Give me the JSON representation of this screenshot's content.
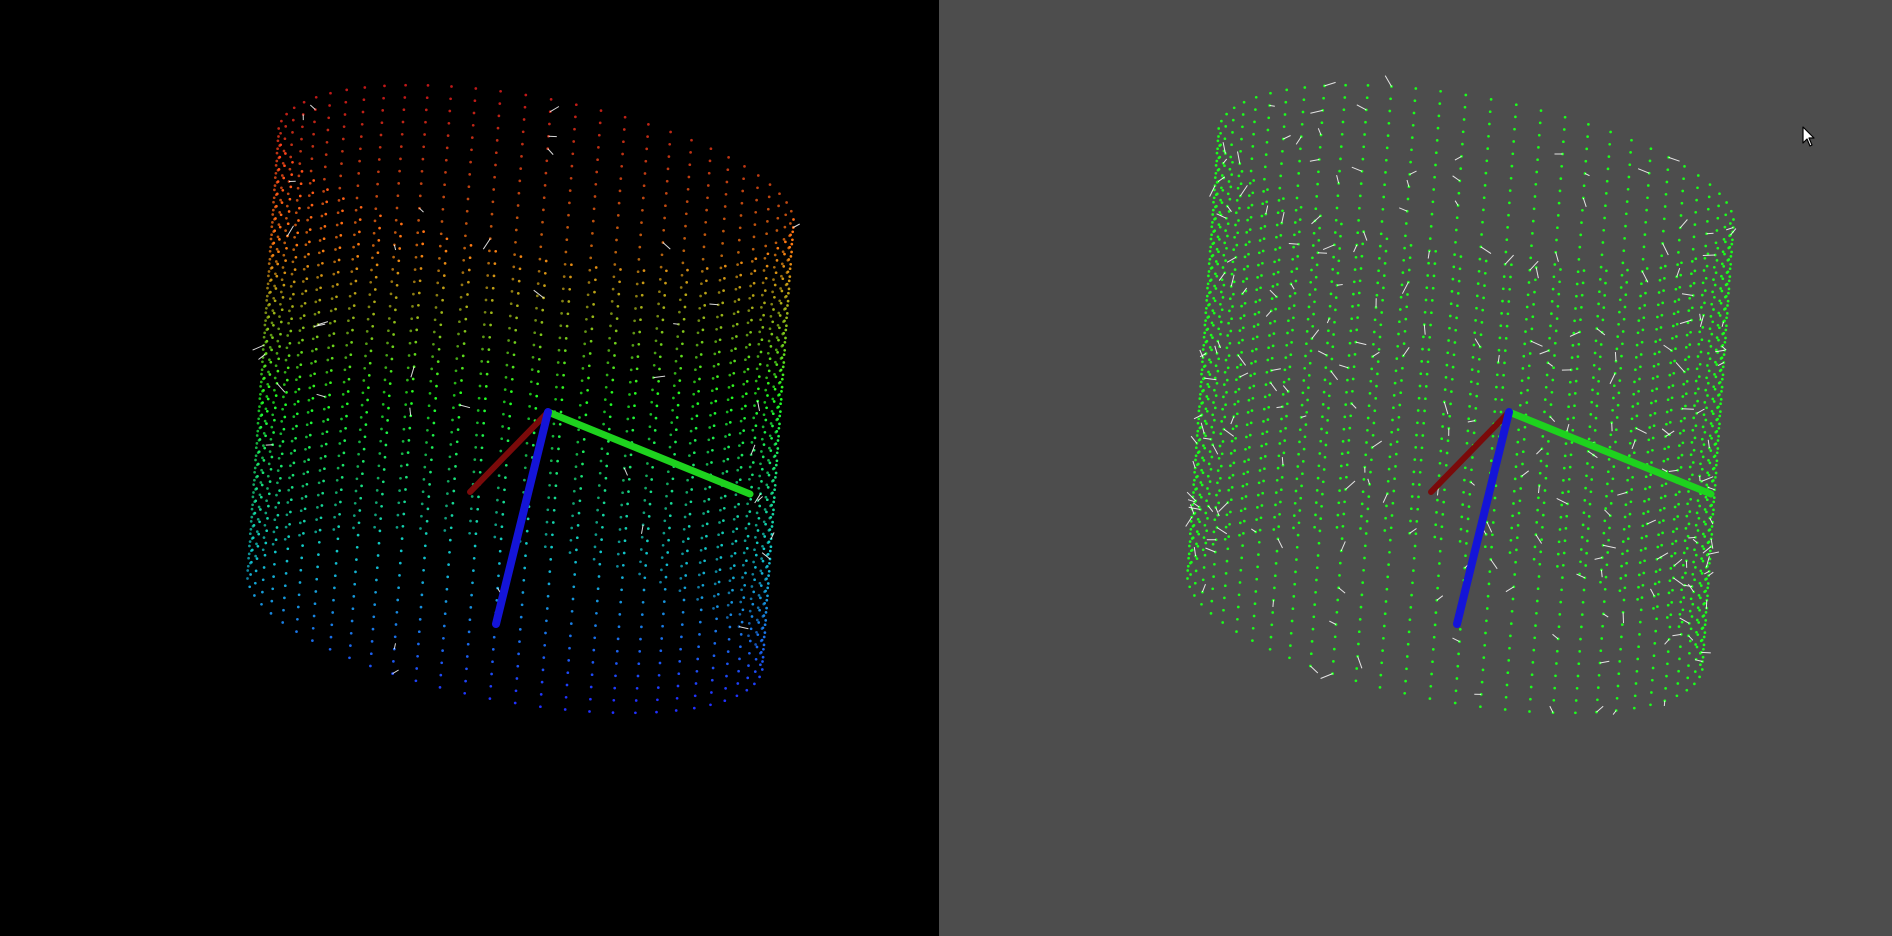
{
  "window": {
    "viewports": [
      {
        "name": "left",
        "background_color": "#000000",
        "point_coloring": "height-gradient",
        "gradient_colors": [
          "#ff2020",
          "#ff7a10",
          "#20ff20",
          "#10c8c8",
          "#2030ff"
        ]
      },
      {
        "name": "right",
        "background_color": "#4d4d4d",
        "point_coloring": "uniform",
        "point_color": "#1aff1a",
        "normal_color": "#ffffff",
        "shows_normals": true
      }
    ],
    "axes_colors": {
      "x": "#7a0a0a",
      "y": "#1ed21e",
      "z": "#1414d8"
    }
  },
  "scene": {
    "object_type": "point-cloud",
    "shape": "cylinder-shell"
  },
  "cursor": {
    "icon": "arrow-pointer-icon"
  }
}
